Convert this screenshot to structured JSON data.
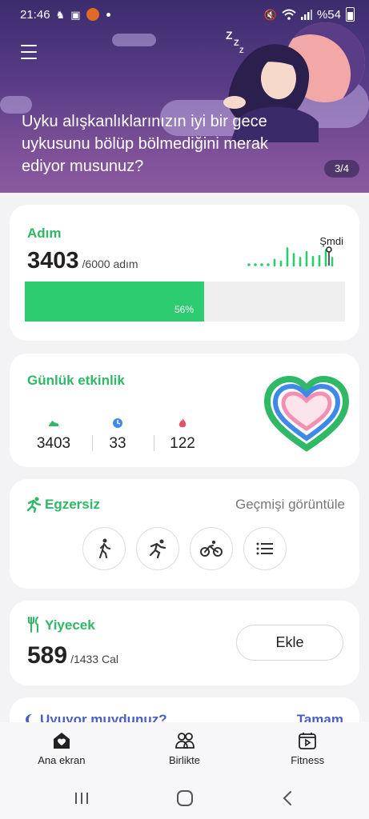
{
  "status_bar": {
    "time": "21:46",
    "battery": "%54"
  },
  "banner": {
    "text": "Uyku alışkanlıklarınızın iyi bir gece uykusunu bölüp bölmediğini merak ediyor musunuz?",
    "page_indicator": "3/4"
  },
  "steps": {
    "title": "Adım",
    "count": "3403",
    "goal": "/6000 adım",
    "now_label": "Şmdi",
    "progress_percent": 56,
    "progress_label": "56%",
    "spark_values": [
      0.1,
      0.15,
      0.1,
      0.15,
      0.3,
      0.2,
      0.9,
      0.6,
      0.4,
      0.7,
      0.45,
      0.5,
      0.8,
      0.4
    ],
    "accent": "#2ecc71"
  },
  "daily_activity": {
    "title": "Günlük etkinlik",
    "stats": [
      {
        "icon": "shoe-icon",
        "value": "3403",
        "color": "#2fb865"
      },
      {
        "icon": "clock-icon",
        "value": "33",
        "color": "#3f8ae8"
      },
      {
        "icon": "flame-icon",
        "value": "122",
        "color": "#e8506a"
      }
    ]
  },
  "exercise": {
    "title": "Egzersiz",
    "history_link": "Geçmişi görüntüle",
    "buttons": [
      "walking-icon",
      "running-icon",
      "cycling-icon",
      "list-icon"
    ]
  },
  "food": {
    "title": "Yiyecek",
    "calories": "589",
    "goal": "/1433 Cal",
    "add_label": "Ekle"
  },
  "sleep_peek": {
    "title": "Uyuyor muydunuz?",
    "action": "Tamam"
  },
  "bottom_nav": [
    {
      "label": "Ana ekran",
      "icon": "home-icon"
    },
    {
      "label": "Birlikte",
      "icon": "people-icon"
    },
    {
      "label": "Fitness",
      "icon": "fitness-icon"
    }
  ]
}
